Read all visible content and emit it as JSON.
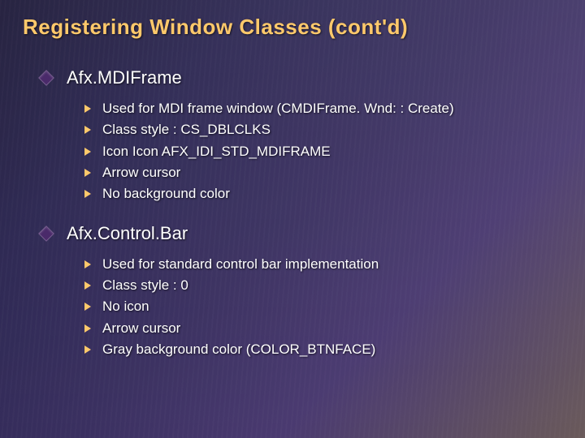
{
  "title": "Registering Window Classes (cont'd)",
  "sections": [
    {
      "heading": "Afx.MDIFrame",
      "items": [
        "Used for MDI frame window (CMDIFrame. Wnd: : Create)",
        "Class style : CS_DBLCLKS",
        "Icon Icon AFX_IDI_STD_MDIFRAME",
        "Arrow cursor",
        "No background color"
      ]
    },
    {
      "heading": "Afx.Control.Bar",
      "items": [
        "Used for standard control bar implementation",
        "Class style : 0",
        "No icon",
        "Arrow cursor",
        "Gray background color (COLOR_BTNFACE)"
      ]
    }
  ]
}
